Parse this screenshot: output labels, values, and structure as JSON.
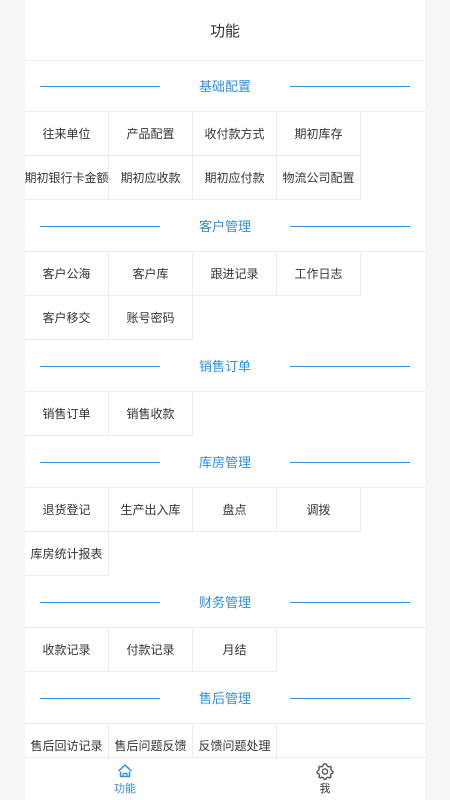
{
  "header": {
    "title": "功能"
  },
  "sections": [
    {
      "title": "基础配置",
      "items": [
        "往来单位",
        "产品配置",
        "收付款方式",
        "期初库存",
        "期初银行卡金额",
        "期初应收款",
        "期初应付款",
        "物流公司配置"
      ]
    },
    {
      "title": "客户管理",
      "items": [
        "客户公海",
        "客户库",
        "跟进记录",
        "工作日志",
        "客户移交",
        "账号密码"
      ]
    },
    {
      "title": "销售订单",
      "items": [
        "销售订单",
        "销售收款"
      ]
    },
    {
      "title": "库房管理",
      "items": [
        "退货登记",
        "生产出入库",
        "盘点",
        "调拨",
        "库房统计报表"
      ]
    },
    {
      "title": "财务管理",
      "items": [
        "收款记录",
        "付款记录",
        "月结"
      ]
    },
    {
      "title": "售后管理",
      "items": [
        "售后回访记录",
        "售后问题反馈",
        "反馈问题处理"
      ]
    }
  ],
  "tabbar": {
    "tabs": [
      {
        "label": "功能",
        "icon": "home-icon",
        "active": true
      },
      {
        "label": "我",
        "icon": "gear-icon",
        "active": false
      }
    ]
  },
  "colors": {
    "accent": "#2e8fe0",
    "divider": "#ededed",
    "background": "#f7f7f7"
  }
}
